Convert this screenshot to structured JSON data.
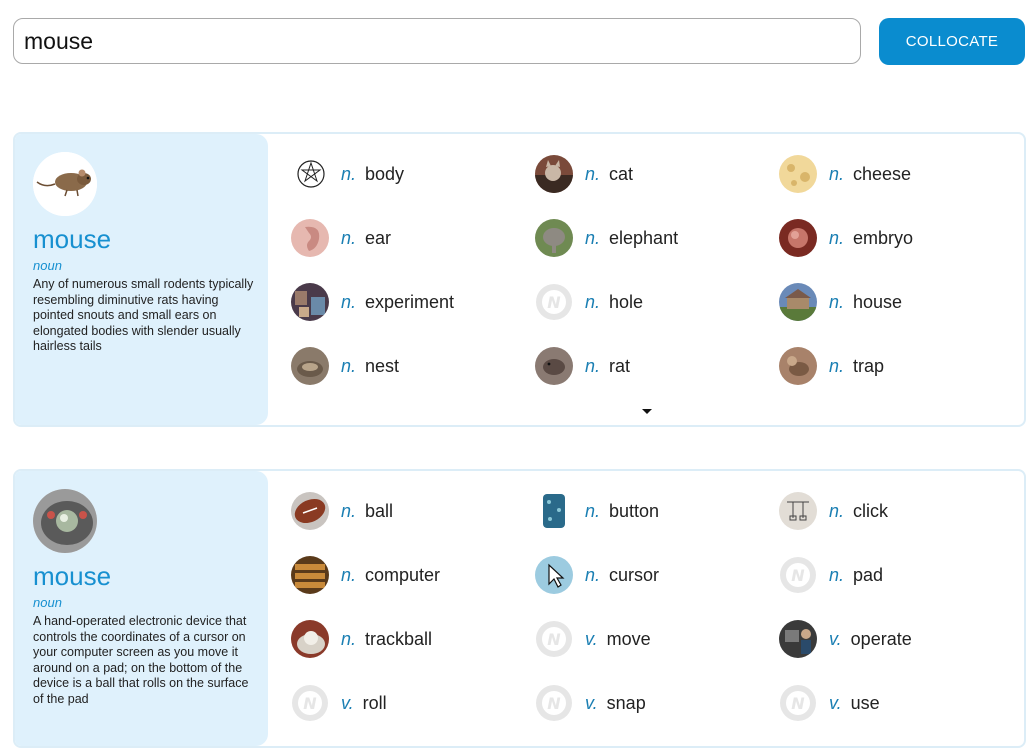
{
  "search": {
    "value": "mouse",
    "button_label": "COLLOCATE"
  },
  "senses": [
    {
      "word": "mouse",
      "pos": "noun",
      "definition": "Any of numerous small rodents typically resembling diminutive rats having pointed snouts and small ears on elongated bodies with slender usually hairless tails",
      "avatar": "mouse-animal-photo",
      "collocates": [
        {
          "pos": "n.",
          "word": "body",
          "thumb": "pentagram-drawing"
        },
        {
          "pos": "n.",
          "word": "cat",
          "thumb": "cat-photo"
        },
        {
          "pos": "n.",
          "word": "cheese",
          "thumb": "cheese-photo"
        },
        {
          "pos": "n.",
          "word": "ear",
          "thumb": "ear-photo"
        },
        {
          "pos": "n.",
          "word": "elephant",
          "thumb": "elephant-photo"
        },
        {
          "pos": "n.",
          "word": "embryo",
          "thumb": "embryo-photo"
        },
        {
          "pos": "n.",
          "word": "experiment",
          "thumb": "experiment-photo"
        },
        {
          "pos": "n.",
          "word": "hole",
          "thumb": "placeholder-n-icon"
        },
        {
          "pos": "n.",
          "word": "house",
          "thumb": "house-photo"
        },
        {
          "pos": "n.",
          "word": "nest",
          "thumb": "nest-photo"
        },
        {
          "pos": "n.",
          "word": "rat",
          "thumb": "rat-photo"
        },
        {
          "pos": "n.",
          "word": "trap",
          "thumb": "trap-photo"
        }
      ]
    },
    {
      "word": "mouse",
      "pos": "noun",
      "definition": "A hand-operated electronic device that controls the coordinates of a cursor on your computer screen as you move it around on a pad; on the bottom of the device is a ball that rolls on the surface of the pad",
      "avatar": "computer-mouse-photo",
      "collocates": [
        {
          "pos": "n.",
          "word": "ball",
          "thumb": "football-photo"
        },
        {
          "pos": "n.",
          "word": "button",
          "thumb": "button-photo"
        },
        {
          "pos": "n.",
          "word": "click",
          "thumb": "click-diagram"
        },
        {
          "pos": "n.",
          "word": "computer",
          "thumb": "computer-photo"
        },
        {
          "pos": "n.",
          "word": "cursor",
          "thumb": "cursor-arrow-icon"
        },
        {
          "pos": "n.",
          "word": "pad",
          "thumb": "placeholder-n-icon"
        },
        {
          "pos": "n.",
          "word": "trackball",
          "thumb": "trackball-photo"
        },
        {
          "pos": "v.",
          "word": "move",
          "thumb": "placeholder-n-icon"
        },
        {
          "pos": "v.",
          "word": "operate",
          "thumb": "operate-photo"
        },
        {
          "pos": "v.",
          "word": "roll",
          "thumb": "placeholder-n-icon"
        },
        {
          "pos": "v.",
          "word": "snap",
          "thumb": "placeholder-n-icon"
        },
        {
          "pos": "v.",
          "word": "use",
          "thumb": "placeholder-n-icon"
        }
      ]
    }
  ]
}
